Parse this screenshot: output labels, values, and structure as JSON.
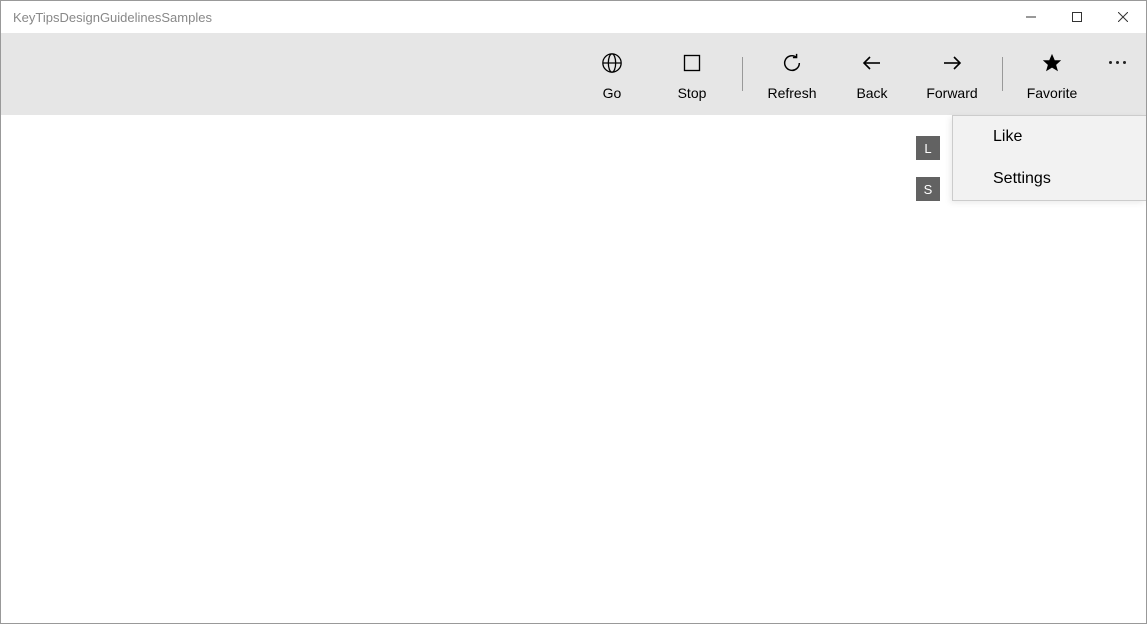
{
  "window": {
    "title": "KeyTipsDesignGuidelinesSamples"
  },
  "commandbar": {
    "items": [
      {
        "label": "Go"
      },
      {
        "label": "Stop"
      },
      {
        "label": "Refresh"
      },
      {
        "label": "Back"
      },
      {
        "label": "Forward"
      },
      {
        "label": "Favorite"
      }
    ]
  },
  "flyout": {
    "items": [
      {
        "label": "Like",
        "keytip": "L"
      },
      {
        "label": "Settings",
        "keytip": "S"
      }
    ]
  }
}
